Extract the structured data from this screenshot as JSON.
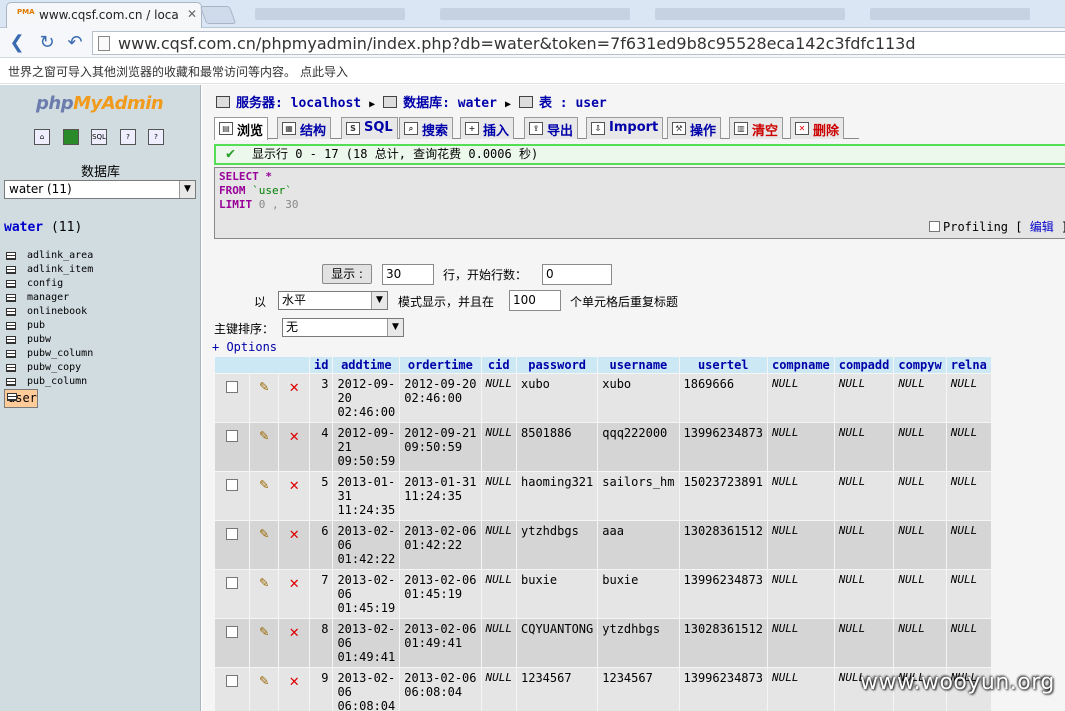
{
  "browser": {
    "tab_title": "www.cqsf.com.cn / local",
    "tab_favicon": "PMA",
    "url": "www.cqsf.com.cn/phpmyadmin/index.php?db=water&token=7f631ed9b8c95528eca142c3fdfc113d",
    "infobar_text": "世界之窗可导入其他浏览器的收藏和最常访问等内容。",
    "infobar_link": "点此导入"
  },
  "left": {
    "logo_php": "php",
    "logo_my": "MyAdmin",
    "db_label": "数据库",
    "db_select": "water (11)",
    "db_name": "water",
    "db_count": "(11)",
    "tables": [
      "adlink_area",
      "adlink_item",
      "config",
      "manager",
      "onlinebook",
      "pub",
      "pubw",
      "pubw_column",
      "pubw_copy",
      "pub_column",
      "user"
    ]
  },
  "crumb": {
    "server_label": "服务器:",
    "server": "localhost",
    "db_label": "数据库:",
    "db": "water",
    "table_label": "表 :",
    "table": "user"
  },
  "tabs": [
    "浏览",
    "结构",
    "SQL",
    "搜索",
    "插入",
    "导出",
    "Import",
    "操作",
    "清空",
    "删除"
  ],
  "result": {
    "message": "显示行 0 - 17 (18 总计, 查询花费 0.0006 秒)",
    "sql_select": "SELECT",
    "sql_star": "*",
    "sql_from": "FROM",
    "sql_table": "`user`",
    "sql_limit": "LIMIT",
    "sql_offset": "0",
    "sql_comma": ",",
    "sql_count": "30",
    "profiling": "Profiling",
    "edit_link": "编辑"
  },
  "nav": {
    "show_button": "显示 :",
    "rows_value": "30",
    "rows_label": "行，开始行数：",
    "start_value": "0",
    "mode_prefix": "以",
    "mode_value": "水平",
    "mode_label": "模式显示，并且在",
    "repeat_value": "100",
    "repeat_label": "个单元格后重复标题",
    "sort_label": "主键排序：",
    "sort_value": "无",
    "options": "+ Options"
  },
  "table": {
    "columns": [
      "id",
      "addtime",
      "ordertime",
      "cid",
      "password",
      "username",
      "usertel",
      "compname",
      "compadd",
      "compyw",
      "relna"
    ],
    "rows": [
      [
        "3",
        "2012-09-\n20\n02:46:00",
        "2012-09-20\n02:46:00",
        "NULL",
        "xubo",
        "xubo",
        "1869666",
        "NULL",
        "NULL",
        "NULL",
        "NULL"
      ],
      [
        "4",
        "2012-09-\n21\n09:50:59",
        "2012-09-21\n09:50:59",
        "NULL",
        "8501886",
        "qqq222000",
        "13996234873",
        "NULL",
        "NULL",
        "NULL",
        "NULL"
      ],
      [
        "5",
        "2013-01-\n31\n11:24:35",
        "2013-01-31\n11:24:35",
        "NULL",
        "haoming321",
        "sailors_hm",
        "15023723891",
        "NULL",
        "NULL",
        "NULL",
        "NULL"
      ],
      [
        "6",
        "2013-02-\n06\n01:42:22",
        "2013-02-06\n01:42:22",
        "NULL",
        "ytzhdbgs",
        "aaa",
        "13028361512",
        "NULL",
        "NULL",
        "NULL",
        "NULL"
      ],
      [
        "7",
        "2013-02-\n06\n01:45:19",
        "2013-02-06\n01:45:19",
        "NULL",
        "buxie",
        "buxie",
        "13996234873",
        "NULL",
        "NULL",
        "NULL",
        "NULL"
      ],
      [
        "8",
        "2013-02-\n06\n01:49:41",
        "2013-02-06\n01:49:41",
        "NULL",
        "CQYUANTONG",
        "ytzdhbgs",
        "13028361512",
        "NULL",
        "NULL",
        "NULL",
        "NULL"
      ],
      [
        "9",
        "2013-02-\n06\n06:08:04",
        "2013-02-06\n06:08:04",
        "NULL",
        "1234567",
        "1234567",
        "13996234873",
        "NULL",
        "NULL",
        "NULL",
        "NULL"
      ]
    ]
  },
  "watermark": "www.wooyun.org"
}
